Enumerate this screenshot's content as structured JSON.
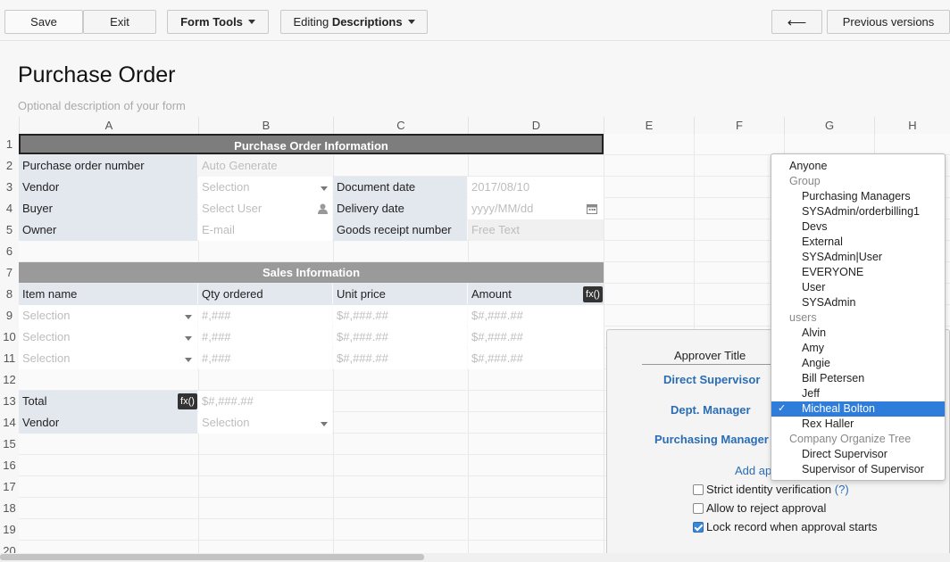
{
  "toolbar": {
    "save": "Save",
    "exit": "Exit",
    "form_tools": "Form Tools",
    "editing_prefix": "Editing",
    "editing_mode": "Descriptions",
    "back_arrow": "⟵",
    "previous_versions": "Previous versions"
  },
  "form": {
    "title": "Purchase Order",
    "description_placeholder": "Optional description of your form"
  },
  "columns": [
    "A",
    "B",
    "C",
    "D",
    "E",
    "F",
    "G",
    "H"
  ],
  "rows": [
    "1",
    "2",
    "3",
    "4",
    "5",
    "6",
    "7",
    "8",
    "9",
    "10",
    "11",
    "12",
    "13",
    "14",
    "15",
    "16",
    "17",
    "18",
    "19",
    "20"
  ],
  "sheet": {
    "section1": "Purchase Order Information",
    "po_number_label": "Purchase order number",
    "po_number_value": "Auto Generate",
    "vendor_label": "Vendor",
    "vendor_value": "Selection",
    "document_date_label": "Document date",
    "document_date_value": "2017/08/10",
    "buyer_label": "Buyer",
    "buyer_value": "Select User",
    "delivery_date_label": "Delivery date",
    "delivery_date_value": "yyyy/MM/dd",
    "owner_label": "Owner",
    "owner_value": "E-mail",
    "goods_receipt_label": "Goods receipt number",
    "goods_receipt_value": "Free Text",
    "section2": "Sales Information",
    "item_name": "Item name",
    "qty_ordered": "Qty ordered",
    "unit_price": "Unit price",
    "amount": "Amount",
    "fx": "fx()",
    "item_rows": [
      {
        "item": "Selection",
        "qty": "#,###",
        "price": "$#,###.##",
        "amount": "$#,###.##"
      },
      {
        "item": "Selection",
        "qty": "#,###",
        "price": "$#,###.##",
        "amount": "$#,###.##"
      },
      {
        "item": "Selection",
        "qty": "#,###",
        "price": "$#,###.##",
        "amount": "$#,###.##"
      }
    ],
    "total_label": "Total",
    "total_value": "$#,###.##",
    "vendor2_label": "Vendor",
    "vendor2_value": "Selection"
  },
  "approval_panel": {
    "approver_title_header": "Approver Title",
    "approvers": [
      "Direct Supervisor",
      "Dept. Manager",
      "Purchasing Manager"
    ],
    "add_approver": "Add ap",
    "options": [
      {
        "label": "Strict identity verification",
        "checked": false,
        "help": "(?)"
      },
      {
        "label": "Allow to reject approval",
        "checked": false
      },
      {
        "label": "Lock record when approval starts",
        "checked": true
      }
    ]
  },
  "user_dropdown": {
    "anyone": "Anyone",
    "group_header": "Group",
    "groups": [
      "Purchasing Managers",
      "SYSAdmin/orderbilling1",
      "Devs",
      "External",
      "SYSAdmin|User",
      "EVERYONE",
      "User",
      "SYSAdmin"
    ],
    "users_header": "users",
    "users": [
      "Alvin",
      "Amy",
      "Angie",
      "Bill Petersen",
      "Jeff",
      "Micheal Bolton",
      "Rex Haller"
    ],
    "selected_user": "Micheal Bolton",
    "org_header": "Company Organize Tree",
    "org": [
      "Direct Supervisor",
      "Supervisor of Supervisor"
    ]
  },
  "colors": {
    "label_bg": "#e3e8ef",
    "section_bg": "#7d7d7d",
    "accent": "#2f7ddb",
    "link": "#2a6db5"
  }
}
